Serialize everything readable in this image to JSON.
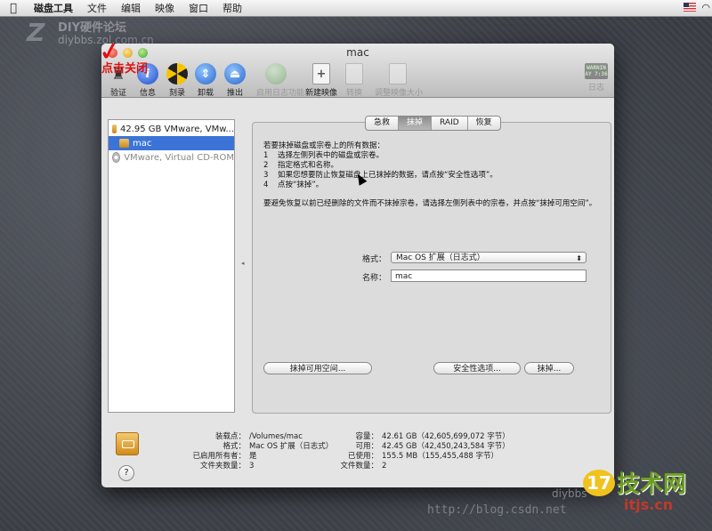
{
  "menubar": {
    "apple": "",
    "items": [
      "磁盘工具",
      "文件",
      "编辑",
      "映像",
      "窗口",
      "帮助"
    ]
  },
  "watermarks": {
    "logo": "Z",
    "title": "DIY硬件论坛",
    "url": "diybbs.zol.com.cn",
    "bottom_url": "http://blog.csdn.net",
    "bottom_diy": "diybbs",
    "site_num": "17",
    "site_name": "技术网",
    "site_domain": "itjs.cn"
  },
  "window": {
    "title": "mac",
    "annotation": "点击关闭",
    "annotation_mark": "✓",
    "toolbar": [
      {
        "label": "验证",
        "icon": "microscope-icon",
        "glyph": "♜",
        "enabled": true
      },
      {
        "label": "信息",
        "icon": "info-icon",
        "glyph": "i",
        "enabled": true
      },
      {
        "label": "刻录",
        "icon": "burn-icon",
        "glyph": "",
        "enabled": true
      },
      {
        "label": "卸载",
        "icon": "unmount-icon",
        "glyph": "⇕",
        "enabled": true
      },
      {
        "label": "推出",
        "icon": "eject-icon",
        "glyph": "⏏",
        "enabled": true
      },
      {
        "label": "启用日志功能",
        "icon": "journal-icon",
        "glyph": "",
        "enabled": false
      },
      {
        "label": "新建映像",
        "icon": "new-image-icon",
        "glyph": "+",
        "enabled": true
      },
      {
        "label": "转换",
        "icon": "convert-icon",
        "glyph": "",
        "enabled": false
      },
      {
        "label": "调整映像大小",
        "icon": "resize-image-icon",
        "glyph": "",
        "enabled": false
      }
    ],
    "log": {
      "label": "日志",
      "icon_text": "WARNIN\nAY 7:36"
    }
  },
  "sidebar": {
    "items": [
      {
        "label": "42.95 GB VMware, VMw...",
        "type": "disk",
        "selected": false
      },
      {
        "label": "mac",
        "type": "volume",
        "selected": true
      },
      {
        "label": "VMware, Virtual CD-ROM",
        "type": "cd",
        "selected": false
      }
    ]
  },
  "tabs": [
    {
      "label": "急救",
      "active": false
    },
    {
      "label": "抹掉",
      "active": true
    },
    {
      "label": "RAID",
      "active": false
    },
    {
      "label": "恢复",
      "active": false
    }
  ],
  "erase": {
    "intro": "若要抹掉磁盘或宗卷上的所有数据：",
    "steps": [
      {
        "n": "1",
        "text": "选择左侧列表中的磁盘或宗卷。"
      },
      {
        "n": "2",
        "text": "指定格式和名称。"
      },
      {
        "n": "3",
        "text": "如果您想要防止恢复磁盘上已抹掉的数据，请点按“安全性选项”。"
      },
      {
        "n": "4",
        "text": "点按“抹掉”。"
      }
    ],
    "note": "要避免恢复以前已经删除的文件而不抹掉宗卷，请选择左侧列表中的宗卷，并点按“抹掉可用空间”。",
    "format_label": "格式：",
    "format_value": "Mac OS 扩展（日志式）",
    "name_label": "名称：",
    "name_value": "mac",
    "erase_free_space": "抹掉可用空间...",
    "security_options": "安全性选项...",
    "erase_button": "抹掉..."
  },
  "footer": {
    "left": [
      {
        "k": "装载点：",
        "v": "/Volumes/mac"
      },
      {
        "k": "格式：",
        "v": "Mac OS 扩展（日志式）"
      },
      {
        "k": "已启用所有者：",
        "v": "是"
      },
      {
        "k": "文件夹数量：",
        "v": "3"
      }
    ],
    "right": [
      {
        "k": "容量：",
        "v": "42.61 GB（42,605,699,072 字节）"
      },
      {
        "k": "可用：",
        "v": "42.45 GB（42,450,243,584 字节）"
      },
      {
        "k": "已使用：",
        "v": "155.5 MB（155,455,488 字节）"
      },
      {
        "k": "文件数量：",
        "v": "2"
      }
    ],
    "help": "?"
  }
}
